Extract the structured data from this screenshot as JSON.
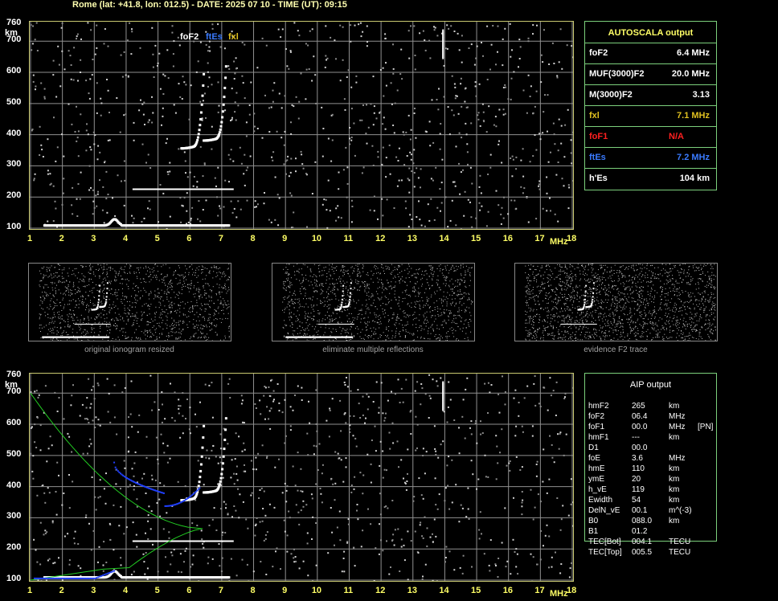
{
  "header": {
    "text": "Rome (lat: +41.8, lon: 012.5) - DATE: 2025 07 10 - TIME (UT): 09:15"
  },
  "axes": {
    "y_ticks": [
      "760",
      "700",
      "600",
      "500",
      "400",
      "300",
      "200",
      "100"
    ],
    "y_unit": "km",
    "x_ticks": [
      "1",
      "2",
      "3",
      "4",
      "5",
      "6",
      "7",
      "8",
      "9",
      "10",
      "11",
      "12",
      "13",
      "14",
      "15",
      "16",
      "17",
      "18"
    ],
    "x_unit": "MHz"
  },
  "markers": {
    "foF2": "foF2",
    "ftEs": "ftEs",
    "fxl": "fxl"
  },
  "autoscala": {
    "title": "AUTOSCALA output",
    "rows": [
      {
        "label": "foF2",
        "value": "6.4 MHz",
        "color": "#ffffff"
      },
      {
        "label": "MUF(3000)F2",
        "value": "20.0 MHz",
        "color": "#ffffff"
      },
      {
        "label": "M(3000)F2",
        "value": "3.13",
        "color": "#ffffff"
      },
      {
        "label": "fxl",
        "value": "7.1 MHz",
        "color": "#e0c020"
      },
      {
        "label": "foF1",
        "value": "N/A",
        "color": "#ff2020"
      },
      {
        "label": "ftEs",
        "value": "7.2 MHz",
        "color": "#3a7bff"
      },
      {
        "label": "h'Es",
        "value": "104    km",
        "color": "#ffffff"
      }
    ]
  },
  "thumbnails": [
    {
      "caption": "original ionogram resized"
    },
    {
      "caption": "eliminate multiple reflections"
    },
    {
      "caption": "evidence F2 trace"
    }
  ],
  "aip": {
    "title": "AIP output",
    "rows": [
      {
        "name": "hmF2",
        "value": "265",
        "unit": "km",
        "extra": ""
      },
      {
        "name": "foF2",
        "value": "06.4",
        "unit": "MHz",
        "extra": ""
      },
      {
        "name": "foF1",
        "value": "00.0",
        "unit": "MHz",
        "extra": "[PN]"
      },
      {
        "name": "hmF1",
        "value": "---",
        "unit": "km",
        "extra": ""
      },
      {
        "name": "D1",
        "value": "00.0",
        "unit": "",
        "extra": ""
      },
      {
        "name": "foE",
        "value": "3.6",
        "unit": "MHz",
        "extra": ""
      },
      {
        "name": "hmE",
        "value": "110",
        "unit": "km",
        "extra": ""
      },
      {
        "name": "ymE",
        "value": "20",
        "unit": "km",
        "extra": ""
      },
      {
        "name": "h_vE",
        "value": "119",
        "unit": "km",
        "extra": ""
      },
      {
        "name": "Ewidth",
        "value": "54",
        "unit": "km",
        "extra": ""
      },
      {
        "name": "DelN_vE",
        "value": "00.1",
        "unit": "m^(-3)",
        "extra": ""
      },
      {
        "name": "B0",
        "value": "088.0",
        "unit": "km",
        "extra": ""
      },
      {
        "name": "B1",
        "value": "01.2",
        "unit": "",
        "extra": ""
      },
      {
        "name": "TEC[Bot]",
        "value": "004.1",
        "unit": "TECU",
        "extra": ""
      },
      {
        "name": "TEC[Top]",
        "value": "005.5",
        "unit": "TECU",
        "extra": ""
      }
    ]
  },
  "colors": {
    "grid": "#909090",
    "frame": "#c8c870",
    "tick": "#ffff66",
    "box": "#7cd07c",
    "profile": "#22cc22",
    "blue_trace": "#2040ff"
  }
}
